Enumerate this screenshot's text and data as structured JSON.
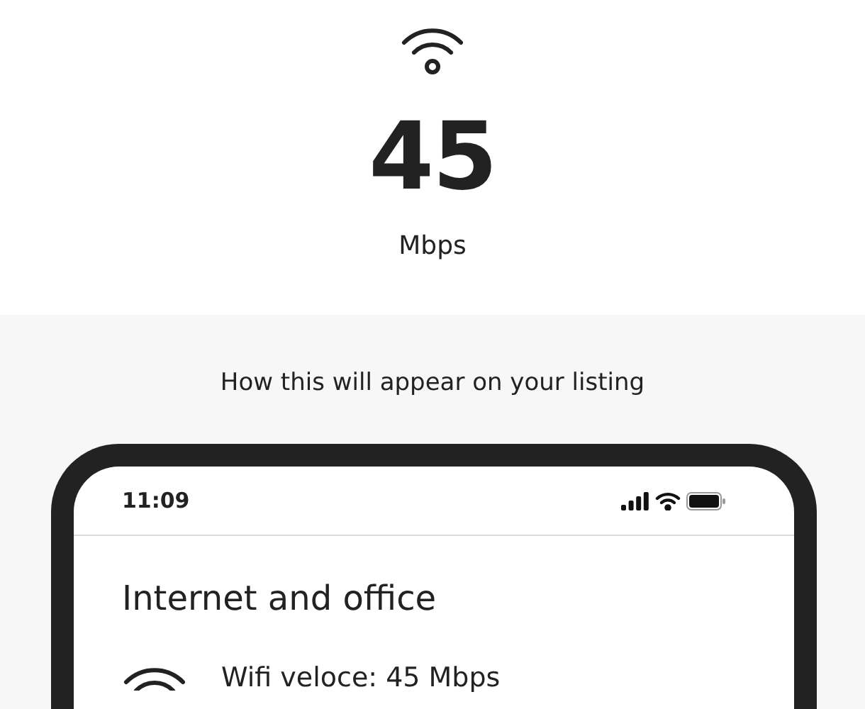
{
  "speed": {
    "value": "45",
    "unit": "Mbps"
  },
  "preview": {
    "caption": "How this will appear on your listing",
    "phone": {
      "time": "11:09",
      "section_title": "Internet and office",
      "items": [
        {
          "text": "Wifi veloce: 45 Mbps"
        }
      ]
    }
  }
}
